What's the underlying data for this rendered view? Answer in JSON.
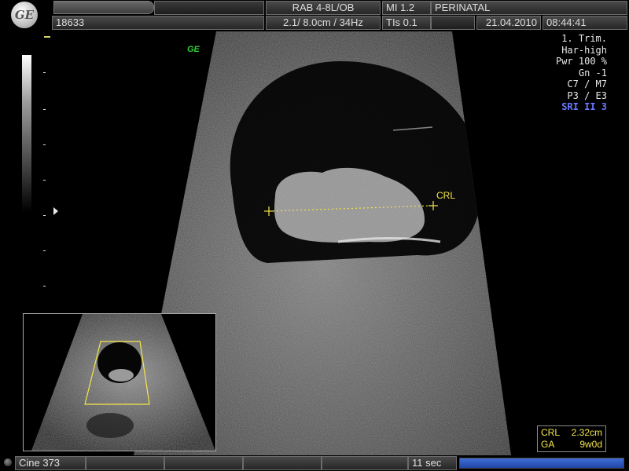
{
  "header": {
    "patient_id": "18633",
    "probe": "RAB 4-8L/OB",
    "settings": "2.1/ 8.0cm / 34Hz",
    "mi": "MI  1.2",
    "tis": "TIs  0.1",
    "application": "PERINATAL",
    "date": "21.04.2010",
    "time": "08:44:41"
  },
  "params": [
    "1. Trim.",
    "Har-high",
    "Pwr 100 %",
    "Gn  -1",
    "C7 / M7",
    "P3 / E3"
  ],
  "sri": "SRI II 3",
  "ge_mark": "GE",
  "measurement": {
    "label": "CRL",
    "results": [
      {
        "name": "CRL",
        "value": "2.32cm"
      },
      {
        "name": "GA",
        "value": "9w0d"
      }
    ]
  },
  "footer": {
    "cine": "Cine 373",
    "duration": "11 sec",
    "cine_progress": 1.0
  },
  "colors": {
    "measurement": "#f2e24a",
    "sri": "#6a78ff",
    "progress": "#2f5bc4"
  }
}
